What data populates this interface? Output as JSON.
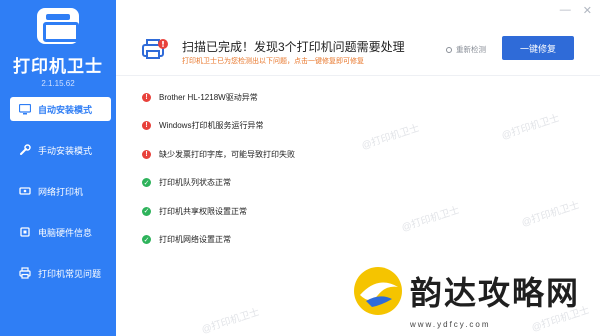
{
  "app": {
    "name": "打印机卫士",
    "version": "2.1.15.62"
  },
  "window_controls": {
    "minimize": "—",
    "close": "✕"
  },
  "sidebar": {
    "items": [
      {
        "label": "自动安装模式",
        "icon": "monitor-icon",
        "active": true
      },
      {
        "label": "手动安装模式",
        "icon": "wrench-icon",
        "active": false
      },
      {
        "label": "网络打印机",
        "icon": "network-icon",
        "active": false
      },
      {
        "label": "电脑硬件信息",
        "icon": "chip-icon",
        "active": false
      },
      {
        "label": "打印机常见问题",
        "icon": "printer-icon",
        "active": false
      }
    ]
  },
  "header": {
    "title": "扫描已完成！发现3个打印机问题需要处理",
    "subtitle": "打印机卫士已为您检测出以下问题，点击一键修复即可修复",
    "rescan_label": "重新检测",
    "fix_button_label": "一键修复"
  },
  "results": [
    {
      "status": "error",
      "text": "Brother  HL-1218W驱动异常"
    },
    {
      "status": "error",
      "text": "Windows打印机服务运行异常"
    },
    {
      "status": "error",
      "text": "缺少发票打印字库，可能导致打印失败"
    },
    {
      "status": "ok",
      "text": "打印机队列状态正常"
    },
    {
      "status": "ok",
      "text": "打印机共享权限设置正常"
    },
    {
      "status": "ok",
      "text": "打印机网络设置正常"
    }
  ],
  "watermark": {
    "text": "@打印机卫士"
  },
  "brand_overlay": {
    "title": "韵达攻略网",
    "url": "www.ydfcy.com"
  },
  "colors": {
    "sidebar": "#2f7ef5",
    "primary_button": "#2f6bd8",
    "error": "#e8413b",
    "ok": "#2eb35b",
    "subtitle": "#e8762a"
  }
}
